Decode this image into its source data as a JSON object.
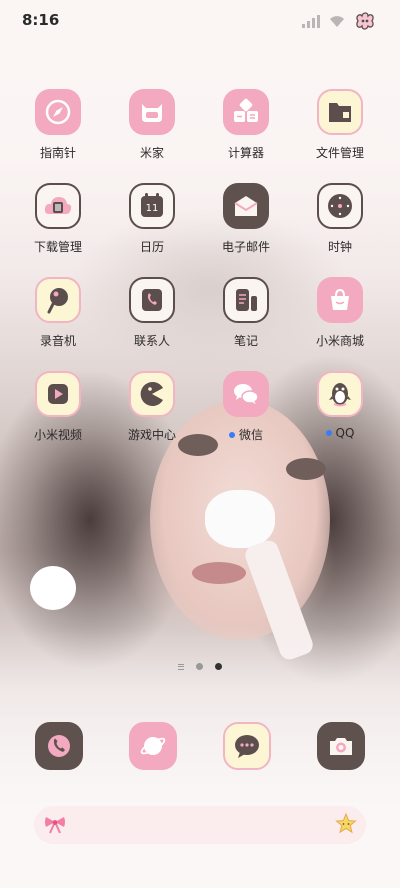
{
  "status_bar": {
    "time": "8:16"
  },
  "apps": [
    {
      "id": "compass",
      "label": "指南针",
      "icon": "compass-icon"
    },
    {
      "id": "mijia",
      "label": "米家",
      "icon": "mijia-cat-icon"
    },
    {
      "id": "calculator",
      "label": "计算器",
      "icon": "calculator-icon"
    },
    {
      "id": "files",
      "label": "文件管理",
      "icon": "folder-icon"
    },
    {
      "id": "downloads",
      "label": "下载管理",
      "icon": "download-cloud-icon"
    },
    {
      "id": "calendar",
      "label": "日历",
      "icon": "calendar-icon",
      "calendar_day": "11"
    },
    {
      "id": "email",
      "label": "电子邮件",
      "icon": "envelope-icon"
    },
    {
      "id": "clock",
      "label": "时钟",
      "icon": "clock-icon"
    },
    {
      "id": "recorder",
      "label": "录音机",
      "icon": "microphone-icon"
    },
    {
      "id": "contacts",
      "label": "联系人",
      "icon": "contact-phone-icon"
    },
    {
      "id": "notes",
      "label": "笔记",
      "icon": "notes-icon"
    },
    {
      "id": "mistore",
      "label": "小米商城",
      "icon": "shopping-bag-icon"
    },
    {
      "id": "video",
      "label": "小米视频",
      "icon": "play-icon"
    },
    {
      "id": "games",
      "label": "游戏中心",
      "icon": "pacman-icon"
    },
    {
      "id": "wechat",
      "label": "微信",
      "icon": "wechat-icon",
      "new_badge": true
    },
    {
      "id": "qq",
      "label": "QQ",
      "icon": "qq-penguin-icon",
      "new_badge": true
    }
  ],
  "dock": [
    {
      "id": "phone",
      "icon": "phone-icon"
    },
    {
      "id": "browser",
      "icon": "browser-planet-icon"
    },
    {
      "id": "messages",
      "icon": "message-bubble-icon"
    },
    {
      "id": "camera",
      "icon": "camera-icon"
    }
  ],
  "pager": {
    "pages": 2,
    "current_page": 2
  },
  "search_bar": {
    "left_icon": "bow-icon",
    "right_icon": "star-icon"
  },
  "colors": {
    "pink_tile": "#f3a9bf",
    "cream_tile": "#fdf6d4",
    "brown_tile": "#5e514e",
    "icon_brown": "#5b4e4c",
    "badge_blue": "#3b7cf3"
  }
}
